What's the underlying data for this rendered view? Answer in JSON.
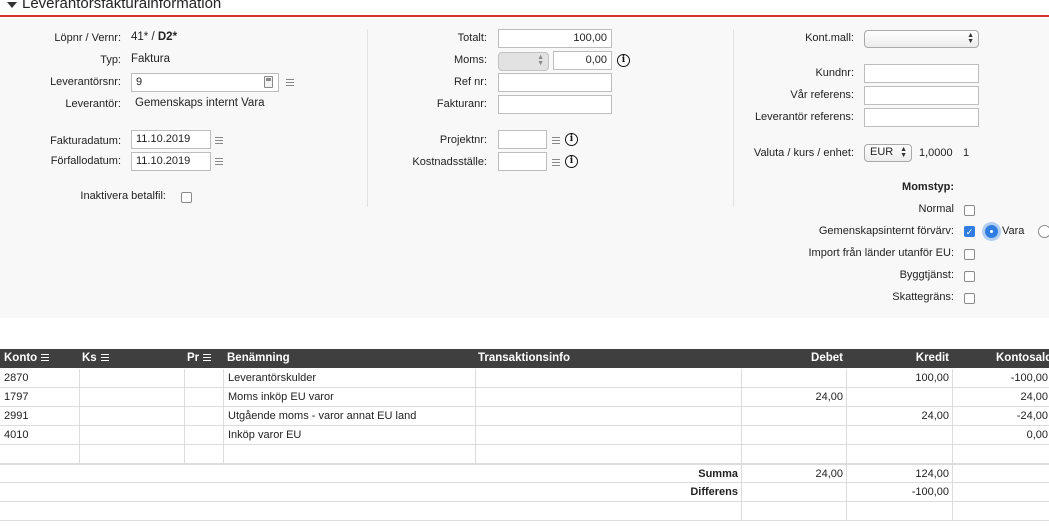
{
  "header": {
    "title": "Leverantörsfakturainformation"
  },
  "col1": {
    "lopnr_label": "Löpnr / Vernr:",
    "lopnr_value": "41*",
    "vernr_sep": " / ",
    "vernr_value": "D2*",
    "typ_label": "Typ:",
    "typ_value": "Faktura",
    "levnr_label": "Leverantörsnr:",
    "levnr_value": "9",
    "lev_label": "Leverantör:",
    "lev_value": "Gemenskaps internt Vara",
    "fakturadatum_label": "Fakturadatum:",
    "fakturadatum_value": "11.10.2019",
    "forfallodatum_label": "Förfallodatum:",
    "forfallodatum_value": "11.10.2019",
    "inaktivera_label": "Inaktivera betalfil:"
  },
  "col2": {
    "totalt_label": "Totalt:",
    "totalt_value": "100,00",
    "moms_label": "Moms:",
    "moms_value": "0,00",
    "refnr_label": "Ref nr:",
    "refnr_value": "",
    "fakturanr_label": "Fakturanr:",
    "fakturanr_value": "",
    "projektnr_label": "Projektnr:",
    "projektnr_value": "",
    "kostnadsstalle_label": "Kostnadsställe:",
    "kostnadsstalle_value": ""
  },
  "col3": {
    "kontmall_label": "Kont.mall:",
    "kontmall_value": "",
    "kundnr_label": "Kundnr:",
    "kundnr_value": "",
    "var_referens_label": "Vår referens:",
    "var_referens_value": "",
    "lev_referens_label": "Leverantör referens:",
    "lev_referens_value": "",
    "valuta_label": "Valuta / kurs / enhet:",
    "valuta_value": "EUR",
    "kurs_value": "1,0000",
    "enhet_value": "1",
    "momstyp_label": "Momstyp:",
    "normal_label": "Normal",
    "gemenskap_label": "Gemenskapsinternt förvärv:",
    "vara_label": "Vara",
    "import_label": "Import från länder utanför EU:",
    "byggtjanst_label": "Byggtjänst:",
    "skattegrans_label": "Skattegräns:"
  },
  "table": {
    "headers": {
      "konto": "Konto",
      "ks": "Ks",
      "pr": "Pr",
      "benamning": "Benämning",
      "transaktionsinfo": "Transaktionsinfo",
      "debet": "Debet",
      "kredit": "Kredit",
      "kontosaldo": "Kontosaldo"
    },
    "rows": [
      {
        "konto": "2870",
        "benamning": "Leverantörskulder",
        "debet": "",
        "kredit": "100,00",
        "saldo": "-100,00"
      },
      {
        "konto": "1797",
        "benamning": "Moms inköp EU varor",
        "debet": "24,00",
        "kredit": "",
        "saldo": "24,00"
      },
      {
        "konto": "2991",
        "benamning": "Utgående moms - varor annat EU land",
        "debet": "",
        "kredit": "24,00",
        "saldo": "-24,00"
      },
      {
        "konto": "4010",
        "benamning": "Inköp varor EU",
        "debet": "",
        "kredit": "",
        "saldo": "0,00"
      }
    ],
    "summa_label": "Summa",
    "summa_debet": "24,00",
    "summa_kredit": "124,00",
    "differens_label": "Differens",
    "differens_value": "-100,00"
  }
}
